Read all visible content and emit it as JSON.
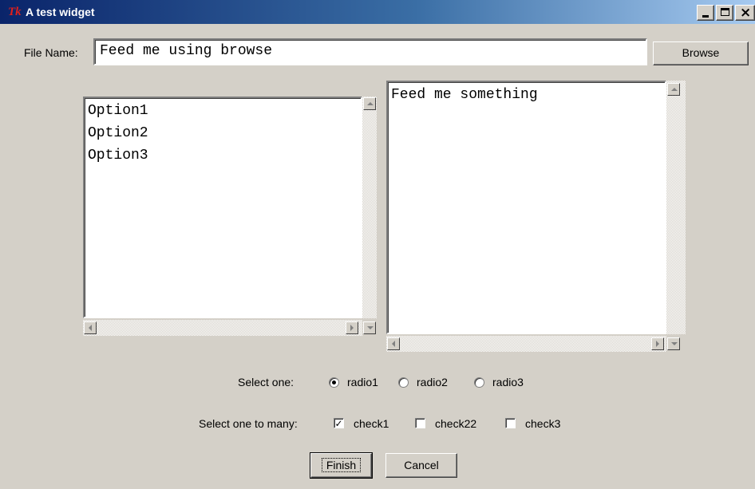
{
  "window": {
    "title": "A test widget",
    "logo": "Tk",
    "icons": [
      "minimize-icon",
      "maximize-icon",
      "close-icon"
    ]
  },
  "file": {
    "label": "File Name:",
    "value": "Feed me using browse",
    "browse_label": "Browse"
  },
  "listbox": {
    "items": [
      "Option1",
      "Option2",
      "Option3"
    ]
  },
  "textbox": {
    "value": "Feed me something"
  },
  "radio": {
    "label": "Select one:",
    "options": [
      "radio1",
      "radio2",
      "radio3"
    ],
    "selected": "radio1"
  },
  "checks": {
    "label": "Select one to many:",
    "options": [
      {
        "label": "check1",
        "checked": true
      },
      {
        "label": "check22",
        "checked": false
      },
      {
        "label": "check3",
        "checked": false
      }
    ]
  },
  "buttons": {
    "finish": "Finish",
    "cancel": "Cancel"
  }
}
